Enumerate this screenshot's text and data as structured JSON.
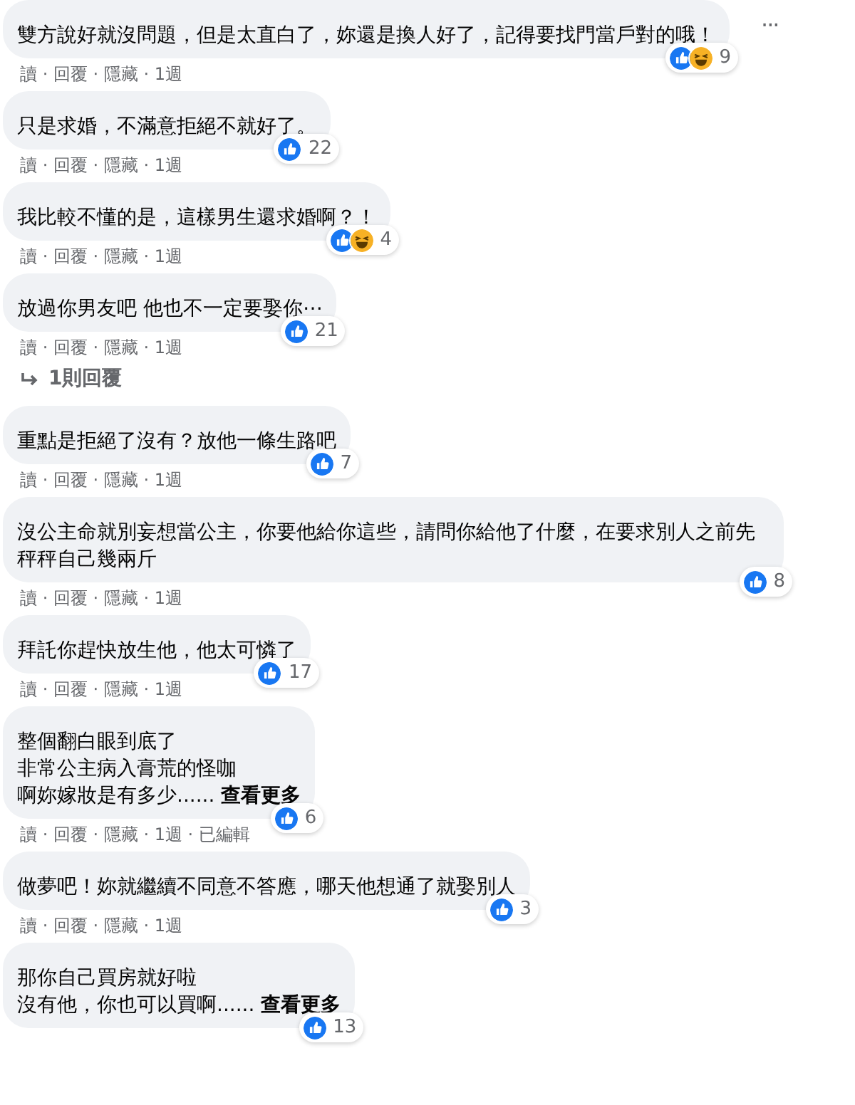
{
  "comments": [
    {
      "lines": [
        "雙方說好就沒問題，但是太直白了，妳還是換人好了，記得要找門當戶對的哦！"
      ],
      "reactions": [
        {
          "kind": "like"
        },
        {
          "kind": "haha"
        }
      ],
      "count": "9",
      "actions": "讀 · 回覆 · 隱藏 · 1週",
      "more_menu": "···"
    },
    {
      "lines": [
        "只是求婚，不滿意拒絕不就好了。"
      ],
      "reactions": [
        {
          "kind": "like"
        }
      ],
      "count": "22",
      "actions": "讀 · 回覆 · 隱藏 · 1週"
    },
    {
      "lines": [
        "我比較不懂的是，這樣男生還求婚啊？！"
      ],
      "reactions": [
        {
          "kind": "like"
        },
        {
          "kind": "haha"
        }
      ],
      "count": "4",
      "actions": "讀 · 回覆 · 隱藏 · 1週"
    },
    {
      "lines": [
        "放過你男友吧 他也不一定要娶你⋯"
      ],
      "reactions": [
        {
          "kind": "like"
        }
      ],
      "count": "21",
      "actions": "讀 · 回覆 · 隱藏 · 1週",
      "replies": "1則回覆"
    },
    {
      "lines": [
        "重點是拒絕了沒有？放他一條生路吧"
      ],
      "reactions": [
        {
          "kind": "like"
        }
      ],
      "count": "7",
      "actions": "讀 · 回覆 · 隱藏 · 1週"
    },
    {
      "lines": [
        "沒公主命就別妄想當公主，你要他給你這些，請問你給他了什麼，在要求別人之前先秤秤自己幾兩斤"
      ],
      "reactions": [
        {
          "kind": "like"
        }
      ],
      "count": "8",
      "actions": "讀 · 回覆 · 隱藏 · 1週"
    },
    {
      "lines": [
        "拜託你趕快放生他，他太可憐了"
      ],
      "reactions": [
        {
          "kind": "like"
        }
      ],
      "count": "17",
      "actions": "讀 · 回覆 · 隱藏 · 1週"
    },
    {
      "lines": [
        "整個翻白眼到底了",
        "非常公主病入膏荒的怪咖",
        "啊妳嫁妝是有多少...... **查看更多**"
      ],
      "reactions": [
        {
          "kind": "like"
        }
      ],
      "count": "6",
      "actions": "讀 · 回覆 · 隱藏 · 1週 · 已編輯"
    },
    {
      "lines": [
        "做夢吧！妳就繼續不同意不答應，哪天他想通了就娶別人"
      ],
      "reactions": [
        {
          "kind": "like"
        }
      ],
      "count": "3",
      "actions": "讀 · 回覆 · 隱藏 · 1週"
    },
    {
      "lines": [
        "那你自己買房就好啦",
        "沒有他，你也可以買啊...... **查看更多**"
      ],
      "reactions": [
        {
          "kind": "like"
        }
      ],
      "count": "13"
    }
  ]
}
